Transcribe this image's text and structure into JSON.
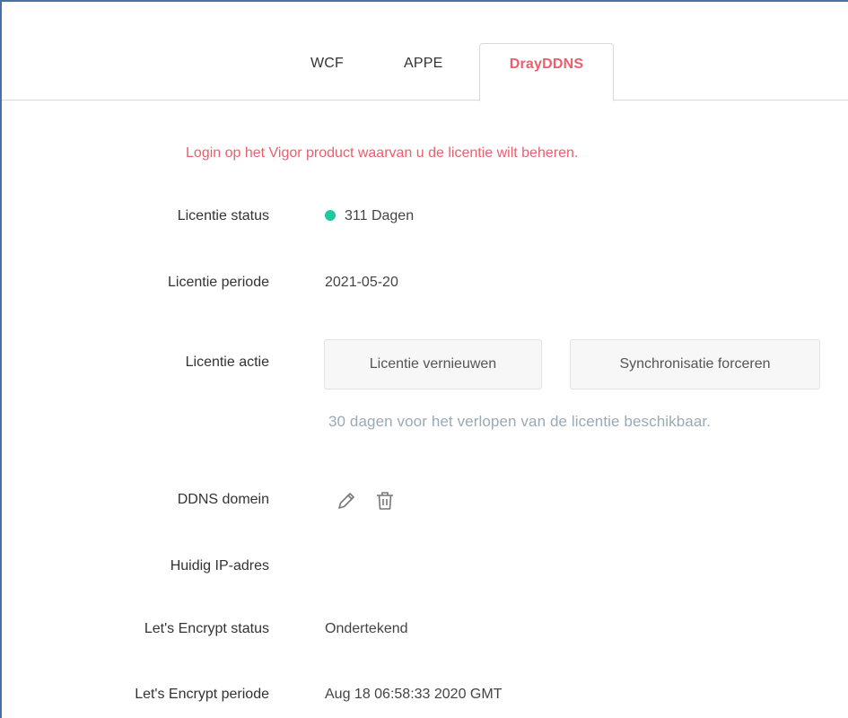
{
  "tabs": [
    {
      "label": "WCF",
      "active": false
    },
    {
      "label": "APPE",
      "active": false
    },
    {
      "label": "DrayDDNS",
      "active": true
    }
  ],
  "notice": "Login op het Vigor product waarvan u de licentie wilt beheren.",
  "rows": {
    "status": {
      "label": "Licentie status",
      "value": "311 Dagen",
      "indicator_color": "#1ec8a0"
    },
    "period": {
      "label": "Licentie periode",
      "value": "2021-05-20"
    },
    "action": {
      "label": "Licentie actie",
      "renew_button": "Licentie vernieuwen",
      "sync_button": "Synchronisatie forceren",
      "hint": "30 dagen voor het verlopen van de licentie beschikbaar."
    },
    "ddns": {
      "label": "DDNS domein",
      "edit_icon": "pencil-icon",
      "delete_icon": "trash-icon"
    },
    "ip": {
      "label": "Huidig IP-adres",
      "value": ""
    },
    "le_status": {
      "label": "Let's Encrypt status",
      "value": "Ondertekend"
    },
    "le_period": {
      "label": "Let's Encrypt periode",
      "value": "Aug 18 06:58:33 2020 GMT"
    }
  },
  "colors": {
    "accent": "#e8606e",
    "hint": "#9aaab5",
    "frame_border": "#4a6fa5"
  }
}
